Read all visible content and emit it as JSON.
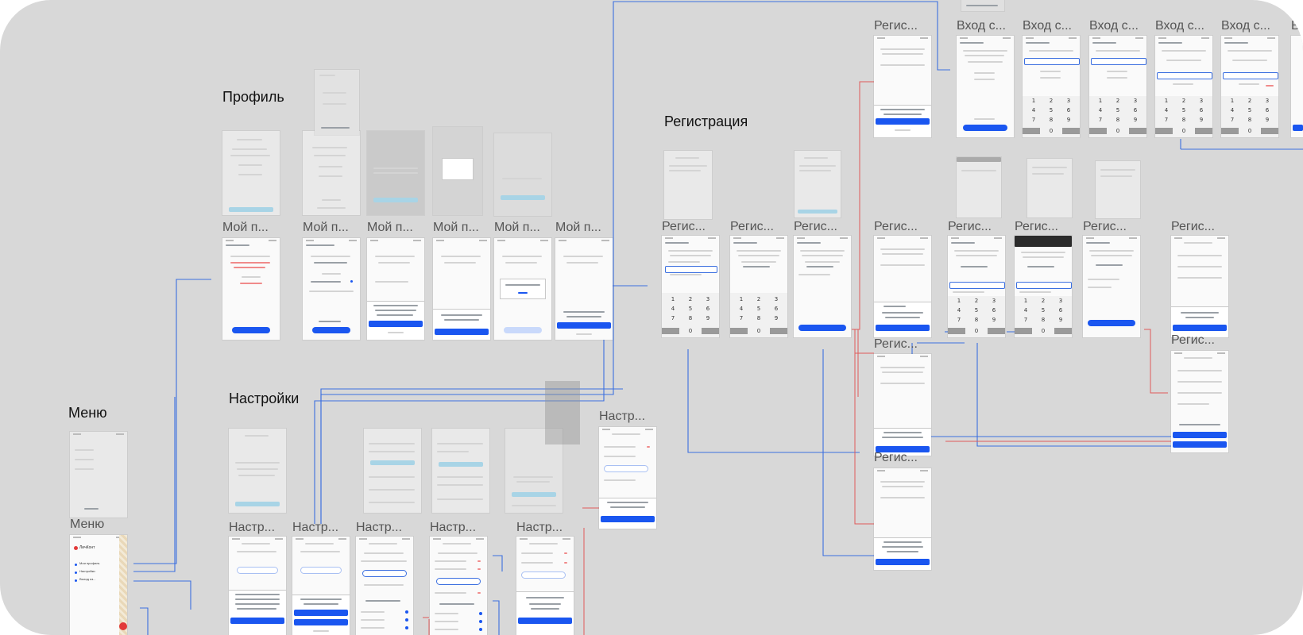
{
  "sections": {
    "menu": "Меню",
    "profile": "Профиль",
    "settings": "Настройки",
    "registration": "Регистрация"
  },
  "frame_labels": {
    "menu": "Меню",
    "profile": [
      "Мой п...",
      "Мой п...",
      "Мой п...",
      "Мой п...",
      "Мой п...",
      "Мой п..."
    ],
    "settings": [
      "Настр...",
      "Настр...",
      "Настр...",
      "Настр...",
      "Настр..."
    ],
    "settings_extra": "Настр...",
    "reg_row1": "Регис...",
    "login_row": [
      "Вход с...",
      "Вход с...",
      "Вход с...",
      "Вход с...",
      "Вход с...",
      "В"
    ],
    "reg_row2": [
      "Регис...",
      "Регис...",
      "Регис...",
      "Регис...",
      "Регис...",
      "Регис...",
      "Регис...",
      "Регис..."
    ],
    "reg_col": [
      "Регис...",
      "Регис..."
    ],
    "reg_right2": "Регис..."
  },
  "menu_screen": {
    "brand": "ЛичКонт",
    "items": [
      "Мои профиль",
      "Настройки",
      "Выход из..."
    ]
  },
  "keypad": {
    "keys": [
      "1",
      "2",
      "3",
      "4",
      "5",
      "6",
      "7",
      "8",
      "9",
      "0"
    ]
  },
  "colors": {
    "canvas_bg": "#d8d8d8",
    "primary_button": "#1a56f0",
    "connector_blue": "#3b6fe0",
    "connector_red": "#e05a5a"
  }
}
